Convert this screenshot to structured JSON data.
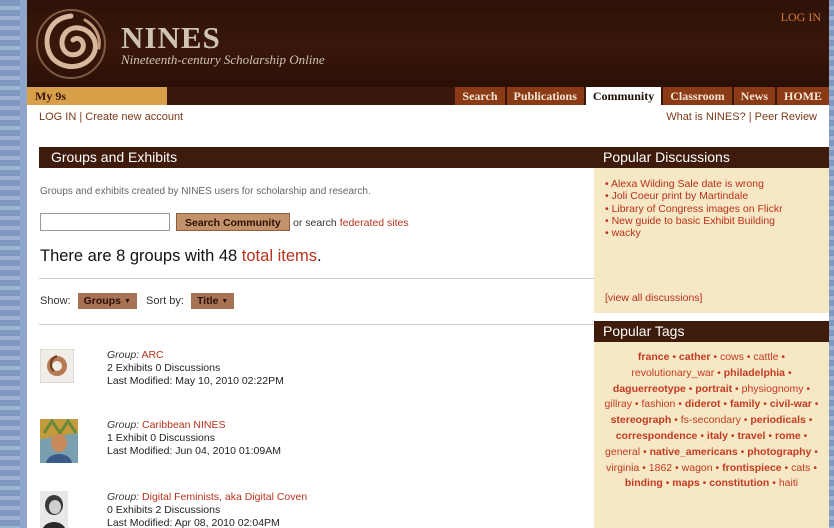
{
  "header": {
    "brand": "NINES",
    "tagline": "Nineteenth-century Scholarship Online",
    "login_link": "LOG IN"
  },
  "tabs": {
    "my9s": "My 9s",
    "items": [
      "Search",
      "Publications",
      "Community",
      "Classroom",
      "News",
      "HOME"
    ],
    "active": "Community"
  },
  "subbar": {
    "login": "LOG IN",
    "separator": "|",
    "create_account": "Create new account",
    "what_is": "What is NINES?",
    "peer_review": "Peer Review"
  },
  "main": {
    "title": "Groups and Exhibits",
    "description": "Groups and exhibits created by NINES users for scholarship and research.",
    "search_button": "Search Community",
    "or_search": "or search",
    "federated_link": "federated sites",
    "count_prefix": "There are 8 groups with 48",
    "count_link": "total items",
    "count_suffix": ".",
    "show_label": "Show:",
    "show_value": "Groups",
    "sort_label": "Sort by:",
    "sort_value": "Title",
    "groups": [
      {
        "label": "Group:",
        "name": "ARC",
        "stats": "2 Exhibits 0 Discussions",
        "modified": "Last Modified: May 10, 2010 02:22PM"
      },
      {
        "label": "Group:",
        "name": "Caribbean NINES",
        "stats": "1 Exhibit 0 Discussions",
        "modified": "Last Modified: Jun 04, 2010 01:09AM"
      },
      {
        "label": "Group:",
        "name": "Digital Feminists, aka Digital Coven",
        "stats": "0 Exhibits 2 Discussions",
        "modified": "Last Modified: Apr 08, 2010 02:04PM"
      }
    ]
  },
  "sidebar": {
    "discussions_title": "Popular Discussions",
    "discussions": [
      "Alexa Wilding Sale date is wrong",
      "Joli Coeur print by Martindale",
      "Library of Congress images on Flickr",
      "New guide to basic Exhibit Building",
      "wacky"
    ],
    "view_all": "[view all discussions]",
    "tags_title": "Popular Tags",
    "tags": [
      {
        "t": "france",
        "b": true
      },
      {
        "t": "cather",
        "b": true
      },
      {
        "t": "cows",
        "b": false
      },
      {
        "t": "cattle",
        "b": false
      },
      {
        "t": "revolutionary_war",
        "b": false
      },
      {
        "t": "philadelphia",
        "b": true
      },
      {
        "t": "daguerreotype",
        "b": true
      },
      {
        "t": "portrait",
        "b": true
      },
      {
        "t": "physiognomy",
        "b": false
      },
      {
        "t": "gillray",
        "b": false
      },
      {
        "t": "fashion",
        "b": false
      },
      {
        "t": "diderot",
        "b": true
      },
      {
        "t": "family",
        "b": true
      },
      {
        "t": "civil-war",
        "b": true
      },
      {
        "t": "stereograph",
        "b": true
      },
      {
        "t": "fs-secondary",
        "b": false
      },
      {
        "t": "periodicals",
        "b": true
      },
      {
        "t": "correspondence",
        "b": true
      },
      {
        "t": "italy",
        "b": true
      },
      {
        "t": "travel",
        "b": true
      },
      {
        "t": "rome",
        "b": true
      },
      {
        "t": "general",
        "b": false
      },
      {
        "t": "native_americans",
        "b": true
      },
      {
        "t": "photography",
        "b": true
      },
      {
        "t": "virginia",
        "b": false
      },
      {
        "t": "1862",
        "b": false
      },
      {
        "t": "wagon",
        "b": false
      },
      {
        "t": "frontispiece",
        "b": true
      },
      {
        "t": "cats",
        "b": false
      },
      {
        "t": "binding",
        "b": true
      },
      {
        "t": "maps",
        "b": true
      },
      {
        "t": "constitution",
        "b": true
      },
      {
        "t": "haiti",
        "b": false
      }
    ]
  },
  "colors": {
    "header_bg": "#3a170a",
    "tab_bg": "#8a3a14",
    "my9s_bg": "#d9a04a",
    "link": "#b8321c",
    "sidebar_bg": "#f6e7c5"
  }
}
